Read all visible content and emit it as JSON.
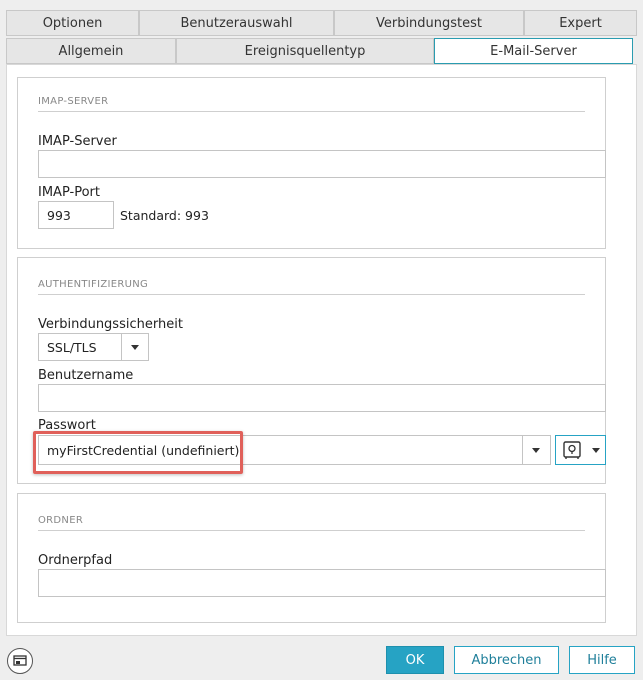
{
  "tabs_row1": [
    {
      "label": "Optionen"
    },
    {
      "label": "Benutzerauswahl"
    },
    {
      "label": "Verbindungstest"
    },
    {
      "label": "Expert"
    }
  ],
  "tabs_row2": [
    {
      "label": "Allgemein"
    },
    {
      "label": "Ereignisquellentyp"
    },
    {
      "label": "E-Mail-Server",
      "active": true
    }
  ],
  "imap": {
    "section_title": "IMAP-SERVER",
    "server_label": "IMAP-Server",
    "server_value": "",
    "port_label": "IMAP-Port",
    "port_value": "993",
    "default_text": "Standard: 993"
  },
  "auth": {
    "section_title": "AUTHENTIFIZIERUNG",
    "security_label": "Verbindungssicherheit",
    "security_value": "SSL/TLS",
    "username_label": "Benutzername",
    "username_value": "",
    "password_label": "Passwort",
    "password_value": "myFirstCredential (undefiniert)"
  },
  "folder": {
    "section_title": "ORDNER",
    "path_label": "Ordnerpfad",
    "path_value": ""
  },
  "footer": {
    "ok_label": "OK",
    "cancel_label": "Abbrechen",
    "help_label": "Hilfe"
  },
  "colors": {
    "accent": "#26a3c4",
    "highlight": "#e0605a"
  }
}
